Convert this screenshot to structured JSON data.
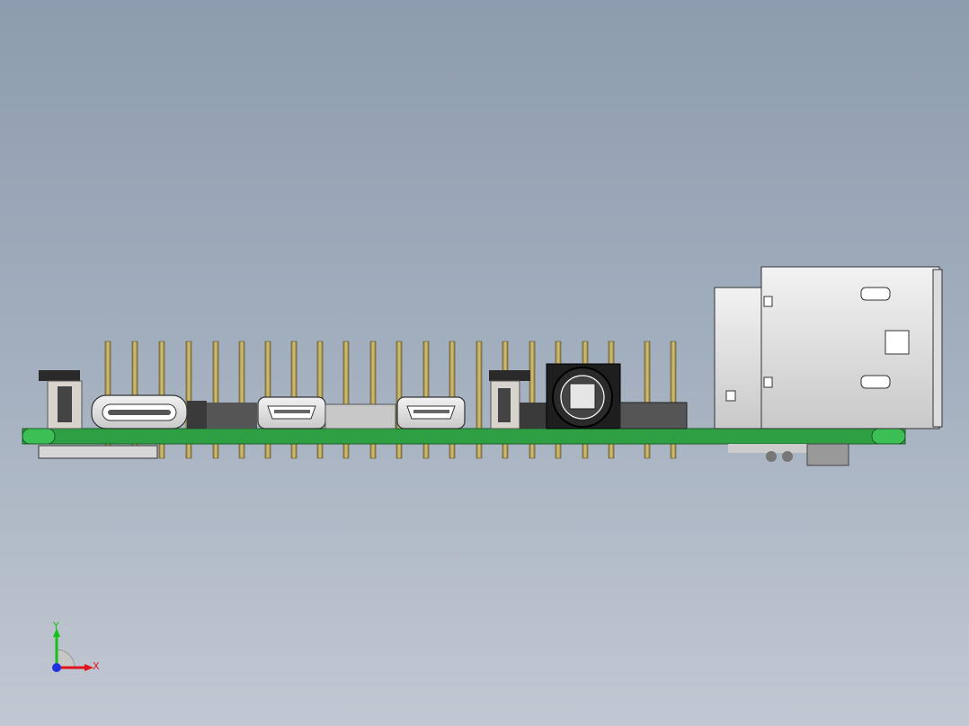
{
  "viewport": {
    "background_top": "#8d9cae",
    "background_bottom": "#c2c8d2"
  },
  "model": {
    "pcb_color": "#2ea043",
    "metal_color": "#e8e8e8",
    "pin_color": "#b8a25a",
    "dark_component_color": "#333333"
  },
  "triad": {
    "x_label": "X",
    "y_label": "Y",
    "x_color": "#e0151c",
    "y_color": "#14c21a",
    "z_color": "#1e32e0"
  }
}
